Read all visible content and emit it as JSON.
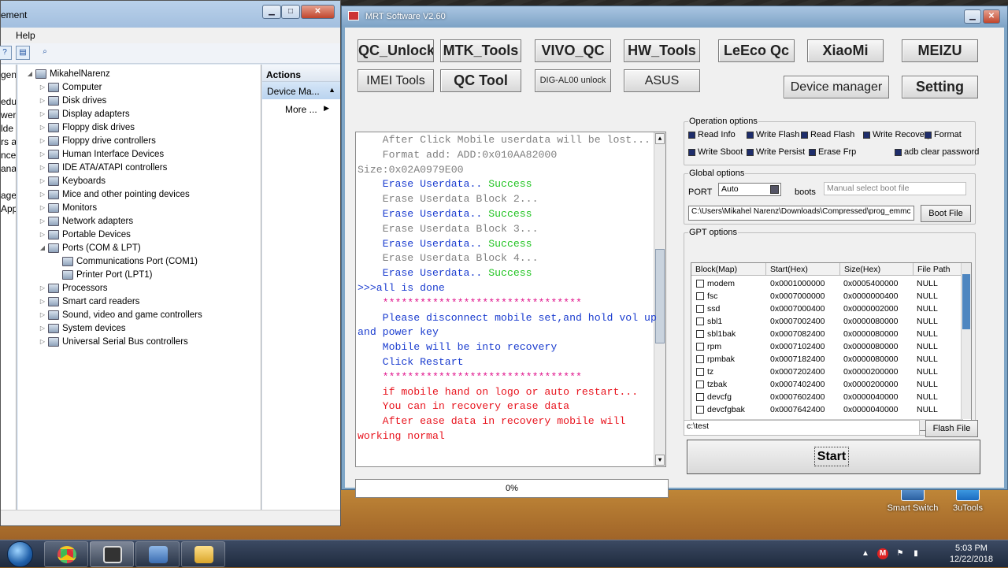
{
  "device_manager": {
    "title": "ement",
    "menu_help": "Help",
    "left_strip": [
      "gen",
      "",
      "edul",
      "wer",
      "lde",
      "rs a",
      "nce",
      "ana",
      "",
      "age",
      "App"
    ],
    "root": "MikahelNarenz",
    "nodes": [
      {
        "label": "Computer",
        "indent": 1
      },
      {
        "label": "Disk drives",
        "indent": 1
      },
      {
        "label": "Display adapters",
        "indent": 1
      },
      {
        "label": "Floppy disk drives",
        "indent": 1
      },
      {
        "label": "Floppy drive controllers",
        "indent": 1
      },
      {
        "label": "Human Interface Devices",
        "indent": 1
      },
      {
        "label": "IDE ATA/ATAPI controllers",
        "indent": 1
      },
      {
        "label": "Keyboards",
        "indent": 1
      },
      {
        "label": "Mice and other pointing devices",
        "indent": 1
      },
      {
        "label": "Monitors",
        "indent": 1
      },
      {
        "label": "Network adapters",
        "indent": 1
      },
      {
        "label": "Portable Devices",
        "indent": 1
      },
      {
        "label": "Ports (COM & LPT)",
        "indent": 1,
        "expanded": true
      },
      {
        "label": "Communications Port (COM1)",
        "indent": 2
      },
      {
        "label": "Printer Port (LPT1)",
        "indent": 2
      },
      {
        "label": "Processors",
        "indent": 1
      },
      {
        "label": "Smart card readers",
        "indent": 1
      },
      {
        "label": "Sound, video and game controllers",
        "indent": 1
      },
      {
        "label": "System devices",
        "indent": 1
      },
      {
        "label": "Universal Serial Bus controllers",
        "indent": 1
      }
    ],
    "actions_header": "Actions",
    "actions_selected": "Device Ma...",
    "actions_more": "More ..."
  },
  "mrt": {
    "title": "MRT Software V2.60",
    "row1": [
      "QC_Unlock",
      "MTK_Tools",
      "VIVO_QC",
      "HW_Tools",
      "LeEco Qc",
      "XiaoMi",
      "MEIZU"
    ],
    "row2": [
      "IMEI Tools",
      "QC Tool",
      "DIG-AL00 unlock",
      "ASUS"
    ],
    "device_manager_btn": "Device manager",
    "setting_btn": "Setting",
    "log": [
      {
        "t": "    After Click Mobile userdata will be lost...",
        "c": "#808080"
      },
      {
        "t": "    Format add: ADD:0x010AA82000",
        "c": "#808080"
      },
      {
        "t": "Size:0x02A0979E00",
        "c": "#808080"
      },
      {
        "t": "    Erase Userdata.. ",
        "c": "#1a3ccf",
        "s": "Success"
      },
      {
        "t": "    Erase Userdata Block 2...",
        "c": "#808080"
      },
      {
        "t": "    Erase Userdata.. ",
        "c": "#1a3ccf",
        "s": "Success"
      },
      {
        "t": "    Erase Userdata Block 3...",
        "c": "#808080"
      },
      {
        "t": "    Erase Userdata.. ",
        "c": "#1a3ccf",
        "s": "Success"
      },
      {
        "t": "    Erase Userdata Block 4...",
        "c": "#808080"
      },
      {
        "t": "    Erase Userdata.. ",
        "c": "#1a3ccf",
        "s": "Success"
      },
      {
        "t": ">>>all is done",
        "c": "#1a3ccf"
      },
      {
        "t": "    ********************************",
        "c": "#e0148c"
      },
      {
        "t": "    Please disconnect mobile set,and hold vol up",
        "c": "#1a3ccf"
      },
      {
        "t": "and power key",
        "c": "#1a3ccf"
      },
      {
        "t": "    Mobile will be into recovery",
        "c": "#1a3ccf"
      },
      {
        "t": "    Click Restart",
        "c": "#1a3ccf"
      },
      {
        "t": "    ********************************",
        "c": "#e0148c"
      },
      {
        "t": "    if mobile hand on logo or auto restart...",
        "c": "#e8141e"
      },
      {
        "t": "    You can in recovery erase data",
        "c": "#e8141e"
      },
      {
        "t": "    After ease data in recovery mobile will",
        "c": "#e8141e"
      },
      {
        "t": "working normal",
        "c": "#e8141e"
      }
    ],
    "success_color": "#22c422",
    "progress": "0%",
    "operation_options": {
      "label": "Operation options",
      "items": [
        "Read Info",
        "Write Flash",
        "Read Flash",
        "Write Recovery",
        "Format",
        "Write Sboot",
        "Write Persist",
        "Erase Frp",
        "adb clear password"
      ]
    },
    "global_options": {
      "label": "Global options",
      "port_label": "PORT",
      "port_value": "Auto",
      "boots_label": "boots",
      "boots_placeholder": "Manual select boot file",
      "path": "C:\\Users\\Mikahel Narenz\\Downloads\\Compressed\\prog_emmc",
      "boot_file_btn": "Boot File"
    },
    "gpt_options": {
      "label": "GPT options",
      "headers": [
        "Block(Map)",
        "Start(Hex)",
        "Size(Hex)",
        "File Path"
      ],
      "rows": [
        [
          "modem",
          "0x0001000000",
          "0x0005400000",
          "NULL"
        ],
        [
          "fsc",
          "0x0007000000",
          "0x0000000400",
          "NULL"
        ],
        [
          "ssd",
          "0x0007000400",
          "0x0000002000",
          "NULL"
        ],
        [
          "sbl1",
          "0x0007002400",
          "0x0000080000",
          "NULL"
        ],
        [
          "sbl1bak",
          "0x0007082400",
          "0x0000080000",
          "NULL"
        ],
        [
          "rpm",
          "0x0007102400",
          "0x0000080000",
          "NULL"
        ],
        [
          "rpmbak",
          "0x0007182400",
          "0x0000080000",
          "NULL"
        ],
        [
          "tz",
          "0x0007202400",
          "0x0000200000",
          "NULL"
        ],
        [
          "tzbak",
          "0x0007402400",
          "0x0000200000",
          "NULL"
        ],
        [
          "devcfg",
          "0x0007602400",
          "0x0000040000",
          "NULL"
        ],
        [
          "devcfgbak",
          "0x0007642400",
          "0x0000040000",
          "NULL"
        ]
      ]
    },
    "flash_path": "c:\\test",
    "flash_file_btn": "Flash File",
    "start_btn": "Start"
  },
  "desktop_icons": [
    "Smart Switch",
    "3uTools"
  ],
  "clock": {
    "time": "5:03 PM",
    "date": "12/22/2018"
  }
}
